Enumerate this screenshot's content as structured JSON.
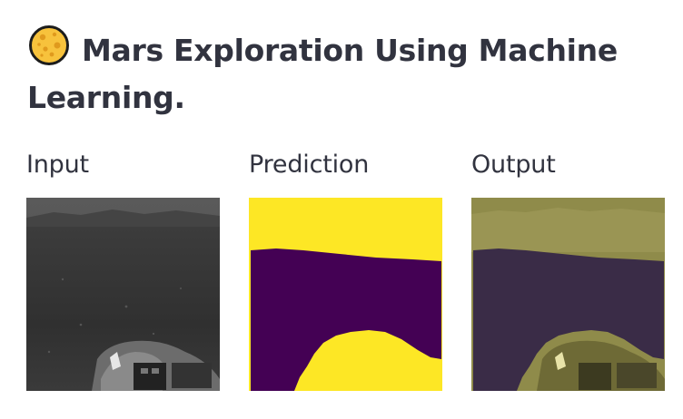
{
  "page": {
    "title": "Mars Exploration Using Machine Learning.",
    "title_icon": "planet-emoji-icon"
  },
  "columns": [
    {
      "heading": "Input",
      "image": "rover-camera-grayscale-terrain"
    },
    {
      "heading": "Prediction",
      "image": "segmentation-mask"
    },
    {
      "heading": "Output",
      "image": "mask-overlay"
    }
  ],
  "colors": {
    "text": "#31333f",
    "mask_yellow": "#fde725",
    "mask_purple": "#440154"
  }
}
